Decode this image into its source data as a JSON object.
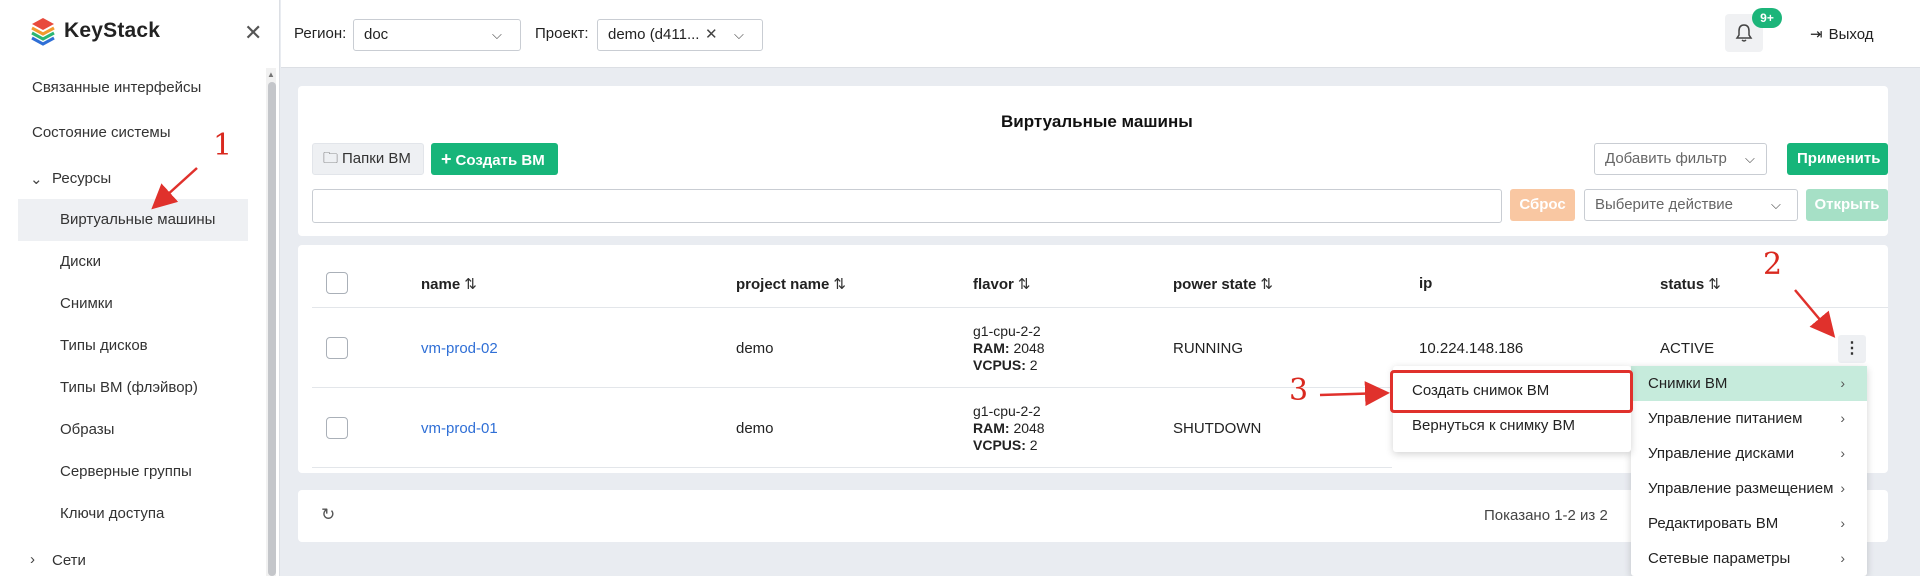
{
  "sidebar": {
    "brand": "KeyStack",
    "items": [
      {
        "label": "Связанные интерфейсы"
      },
      {
        "label": "Состояние системы"
      }
    ],
    "resources": {
      "label": "Ресурсы",
      "items": [
        {
          "label": "Виртуальные машины",
          "active": true
        },
        {
          "label": "Диски"
        },
        {
          "label": "Снимки"
        },
        {
          "label": "Типы дисков"
        },
        {
          "label": "Типы ВМ (флэйвор)"
        },
        {
          "label": "Образы"
        },
        {
          "label": "Серверные группы"
        },
        {
          "label": "Ключи доступа"
        }
      ]
    },
    "networks": {
      "label": "Сети"
    }
  },
  "topbar": {
    "region_label": "Регион:",
    "region_value": "doc",
    "project_label": "Проект:",
    "project_value": "demo (d411...",
    "notifications_badge": "9+",
    "logout_label": "Выход"
  },
  "toolbar": {
    "title": "Виртуальные машины",
    "folders_label": "Папки ВМ",
    "create_label": "Создать ВМ",
    "add_filter_placeholder": "Добавить фильтр",
    "apply_label": "Применить",
    "reset_label": "Сброс",
    "action_placeholder": "Выберите действие",
    "open_label": "Открыть"
  },
  "table": {
    "columns": [
      "name",
      "project name",
      "flavor",
      "power state",
      "ip",
      "status"
    ],
    "rows": [
      {
        "name": "vm-prod-02",
        "project": "demo",
        "flavor_name": "g1-cpu-2-2",
        "ram_label": "RAM:",
        "ram": "2048",
        "vcpus_label": "VCPUS:",
        "vcpus": "2",
        "power_state": "RUNNING",
        "ip": "10.224.148.186",
        "status": "ACTIVE"
      },
      {
        "name": "vm-prod-01",
        "project": "demo",
        "flavor_name": "g1-cpu-2-2",
        "ram_label": "RAM:",
        "ram": "2048",
        "vcpus_label": "VCPUS:",
        "vcpus": "2",
        "power_state": "SHUTDOWN",
        "ip": "",
        "status": ""
      }
    ]
  },
  "footer": {
    "shown_text": "Показано 1-2 из 2"
  },
  "context_menu": {
    "items": [
      {
        "label": "Снимки ВМ",
        "highlighted": true
      },
      {
        "label": "Управление питанием"
      },
      {
        "label": "Управление дисками"
      },
      {
        "label": "Управление размещением"
      },
      {
        "label": "Редактировать ВМ"
      },
      {
        "label": "Сетевые параметры"
      }
    ],
    "submenu": [
      {
        "label": "Создать снимок ВМ"
      },
      {
        "label": "Вернуться к снимку ВМ"
      }
    ]
  },
  "annotations": [
    "1",
    "2",
    "3"
  ],
  "colors": {
    "accent": "#17b57a",
    "link": "#2f6fd6",
    "annotation": "#e0312c"
  }
}
